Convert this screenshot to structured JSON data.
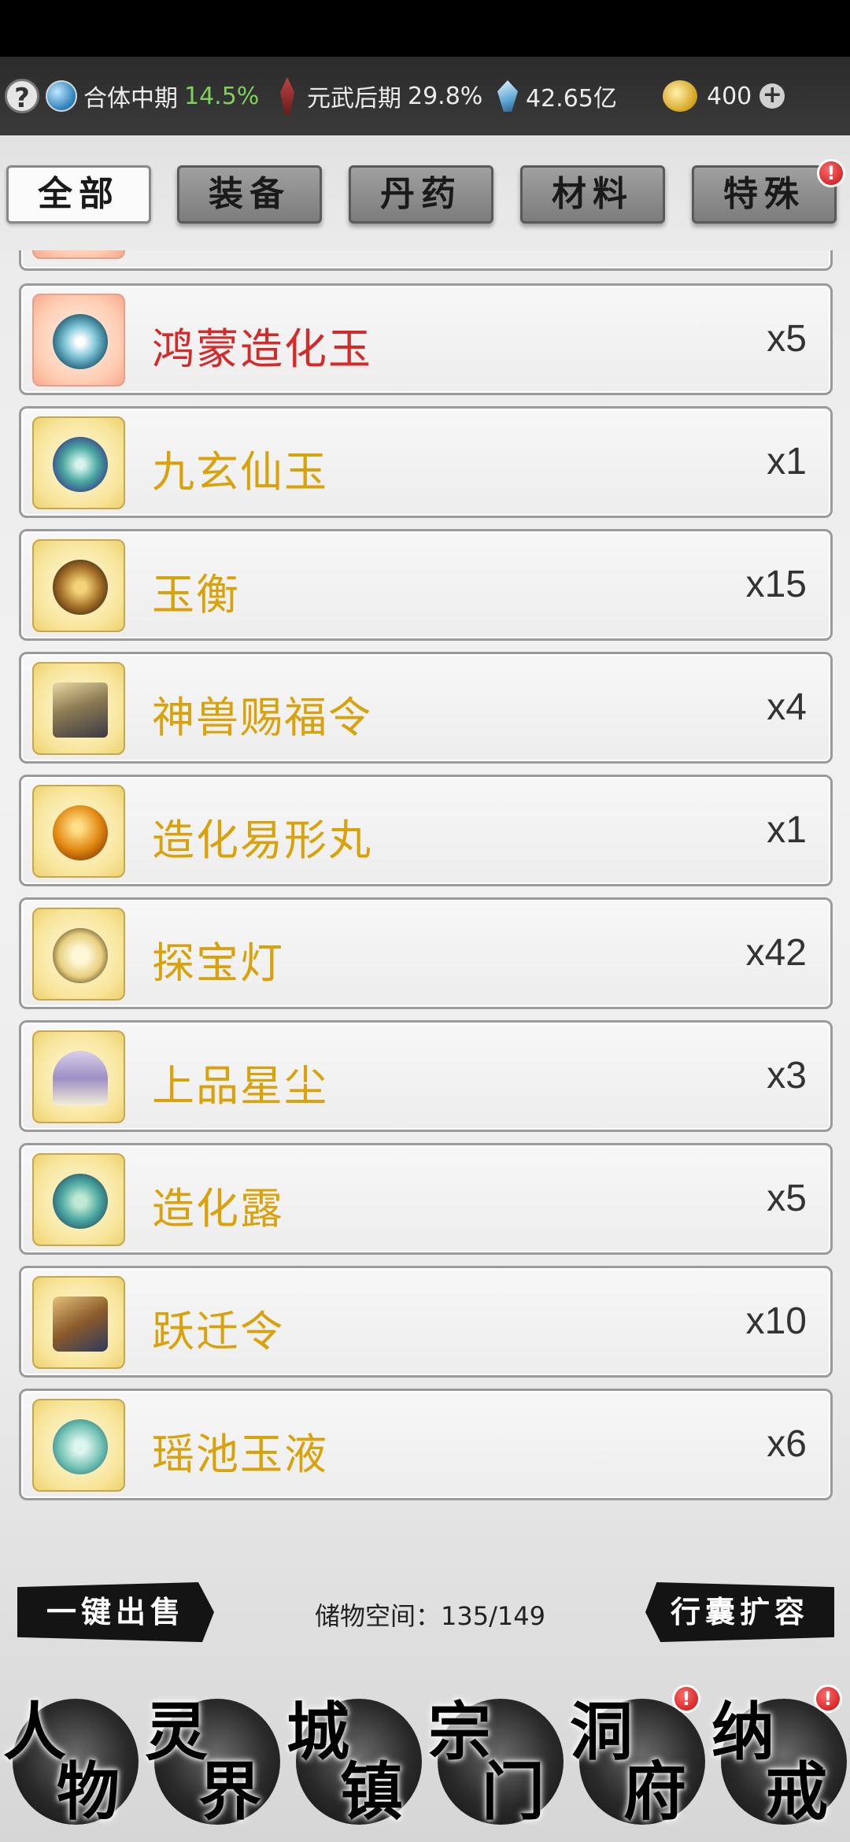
{
  "topbar": {
    "help_symbol": "?",
    "realm": {
      "label": "合体中期",
      "percent": "14.5%"
    },
    "martial": {
      "label": "元武后期",
      "percent": "29.8%"
    },
    "crystals": "42.65亿",
    "coins": "400",
    "plus_symbol": "+"
  },
  "tabs": [
    {
      "label": "全部",
      "active": true
    },
    {
      "label": "装备"
    },
    {
      "label": "丹药"
    },
    {
      "label": "材料"
    },
    {
      "label": "特殊",
      "badge": "!"
    }
  ],
  "items": [
    {
      "name": "鸿蒙造化玉",
      "qty": "x5",
      "rarity": "red",
      "icon": "swirl-jade-icon"
    },
    {
      "name": "九玄仙玉",
      "qty": "x1",
      "rarity": "gold",
      "icon": "fish-jade-icon"
    },
    {
      "name": "玉衡",
      "qty": "x15",
      "rarity": "gold",
      "icon": "bronze-disc-icon"
    },
    {
      "name": "神兽赐福令",
      "qty": "x4",
      "rarity": "gold",
      "icon": "beast-token-icon"
    },
    {
      "name": "造化易形丸",
      "qty": "x1",
      "rarity": "gold",
      "icon": "amber-pill-icon"
    },
    {
      "name": "探宝灯",
      "qty": "x42",
      "rarity": "gold",
      "icon": "lantern-icon"
    },
    {
      "name": "上品星尘",
      "qty": "x3",
      "rarity": "gold",
      "icon": "stardust-bowl-icon"
    },
    {
      "name": "造化露",
      "qty": "x5",
      "rarity": "gold",
      "icon": "gourd-dew-icon"
    },
    {
      "name": "跃迁令",
      "qty": "x10",
      "rarity": "gold",
      "icon": "warp-token-icon"
    },
    {
      "name": "瑶池玉液",
      "qty": "x6",
      "rarity": "gold",
      "icon": "jade-liquid-icon"
    }
  ],
  "bottom": {
    "sell_all": "一键出售",
    "storage_label": "储物空间：135/149",
    "expand": "行囊扩容"
  },
  "nav": [
    {
      "c1": "人",
      "c2": "物"
    },
    {
      "c1": "灵",
      "c2": "界"
    },
    {
      "c1": "城",
      "c2": "镇"
    },
    {
      "c1": "宗",
      "c2": "门"
    },
    {
      "c1": "洞",
      "c2": "府",
      "badge": "!"
    },
    {
      "c1": "纳",
      "c2": "戒",
      "badge": "!"
    }
  ],
  "colors": {
    "gold_text": "#d9a20a",
    "red_text": "#d42a2a",
    "badge": "#c40e0e"
  }
}
